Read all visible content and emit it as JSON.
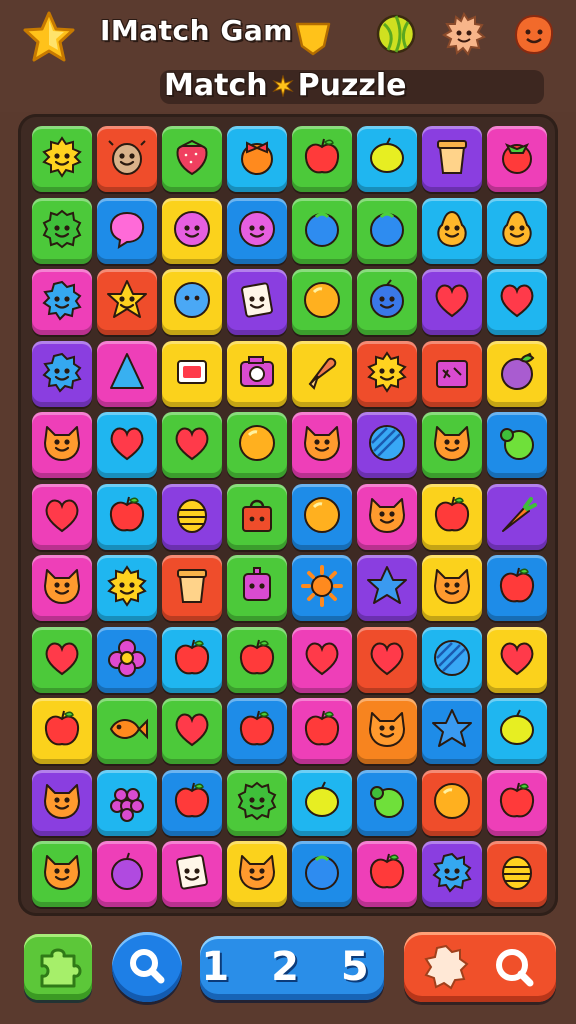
{
  "header": {
    "title": "IMatch Gam",
    "subtitle_left": "Match",
    "subtitle_right": "Puzzle"
  },
  "board": {
    "columns": 8,
    "rows": 11,
    "tiles": [
      [
        {
          "bg": "#4cc93a",
          "icon": "sun-face-icon"
        },
        {
          "bg": "#ef4d2b",
          "icon": "cow-face-icon"
        },
        {
          "bg": "#4cc93a",
          "icon": "strawberry-icon"
        },
        {
          "bg": "#1fb6f0",
          "icon": "orange-bow-icon"
        },
        {
          "bg": "#4cc93a",
          "icon": "apple-icon"
        },
        {
          "bg": "#1fb6f0",
          "icon": "lemon-icon"
        },
        {
          "bg": "#8a3ee0",
          "icon": "cup-icon"
        },
        {
          "bg": "#ee3fb8",
          "icon": "berry-icon"
        }
      ],
      [
        {
          "bg": "#4cc93a",
          "icon": "cactus-face-icon"
        },
        {
          "bg": "#1e8ce8",
          "icon": "bubble-icon"
        },
        {
          "bg": "#fbd21c",
          "icon": "grape-face-icon"
        },
        {
          "bg": "#1e8ce8",
          "icon": "grape-face-icon"
        },
        {
          "bg": "#4cc93a",
          "icon": "blueberry-icon"
        },
        {
          "bg": "#4cc93a",
          "icon": "blueberry-icon"
        },
        {
          "bg": "#1fb6f0",
          "icon": "pear-face-icon"
        },
        {
          "bg": "#1fb6f0",
          "icon": "pear-face-icon"
        }
      ],
      [
        {
          "bg": "#ee3fb8",
          "icon": "splat-face-icon"
        },
        {
          "bg": "#ef4d2b",
          "icon": "star-face-icon"
        },
        {
          "bg": "#fbd21c",
          "icon": "blue-ball-icon"
        },
        {
          "bg": "#8a3ee0",
          "icon": "card-face-icon"
        },
        {
          "bg": "#4cc93a",
          "icon": "orange-ball-icon"
        },
        {
          "bg": "#4cc93a",
          "icon": "plum-face-icon"
        },
        {
          "bg": "#8a3ee0",
          "icon": "heart-icon"
        },
        {
          "bg": "#1fb6f0",
          "icon": "heart-icon"
        }
      ],
      [
        {
          "bg": "#8a3ee0",
          "icon": "splat-face-icon"
        },
        {
          "bg": "#ee3fb8",
          "icon": "triangle-icon"
        },
        {
          "bg": "#fbd21c",
          "icon": "red-square-icon"
        },
        {
          "bg": "#fbd21c",
          "icon": "camera-icon"
        },
        {
          "bg": "#fbd21c",
          "icon": "icecream-icon"
        },
        {
          "bg": "#ef4d2b",
          "icon": "sun-face-icon"
        },
        {
          "bg": "#ef4d2b",
          "icon": "gift-box-icon"
        },
        {
          "bg": "#fbd21c",
          "icon": "fig-icon"
        }
      ],
      [
        {
          "bg": "#ee3fb8",
          "icon": "cat-face-icon"
        },
        {
          "bg": "#1fb6f0",
          "icon": "heart-icon"
        },
        {
          "bg": "#4cc93a",
          "icon": "heart-icon"
        },
        {
          "bg": "#4cc93a",
          "icon": "orange-ball-icon"
        },
        {
          "bg": "#ee3fb8",
          "icon": "cat-face-icon"
        },
        {
          "bg": "#8a3ee0",
          "icon": "striped-ball-icon"
        },
        {
          "bg": "#4cc93a",
          "icon": "cat-face-icon"
        },
        {
          "bg": "#1e8ce8",
          "icon": "lime-icon"
        }
      ],
      [
        {
          "bg": "#ee3fb8",
          "icon": "heart-icon"
        },
        {
          "bg": "#1fb6f0",
          "icon": "apple-icon"
        },
        {
          "bg": "#8a3ee0",
          "icon": "hive-icon"
        },
        {
          "bg": "#4cc93a",
          "icon": "bag-icon"
        },
        {
          "bg": "#1e8ce8",
          "icon": "orange-ball-icon"
        },
        {
          "bg": "#ee3fb8",
          "icon": "cat-face-icon"
        },
        {
          "bg": "#fbd21c",
          "icon": "apple-icon"
        },
        {
          "bg": "#8a3ee0",
          "icon": "carrot-icon"
        }
      ],
      [
        {
          "bg": "#ee3fb8",
          "icon": "cat-face-icon"
        },
        {
          "bg": "#1fb6f0",
          "icon": "sun-face-icon"
        },
        {
          "bg": "#ef4d2b",
          "icon": "cup-icon"
        },
        {
          "bg": "#4cc93a",
          "icon": "robot-icon"
        },
        {
          "bg": "#1e8ce8",
          "icon": "sun-icon"
        },
        {
          "bg": "#8a3ee0",
          "icon": "star-icon"
        },
        {
          "bg": "#fbd21c",
          "icon": "cat-face-icon"
        },
        {
          "bg": "#1e8ce8",
          "icon": "apple-icon"
        }
      ],
      [
        {
          "bg": "#4cc93a",
          "icon": "heart-icon"
        },
        {
          "bg": "#1e8ce8",
          "icon": "flower-icon"
        },
        {
          "bg": "#1fb6f0",
          "icon": "apple-icon"
        },
        {
          "bg": "#4cc93a",
          "icon": "apple-icon"
        },
        {
          "bg": "#ee3fb8",
          "icon": "heart-icon"
        },
        {
          "bg": "#ef4d2b",
          "icon": "heart-icon"
        },
        {
          "bg": "#1fb6f0",
          "icon": "striped-ball-icon"
        },
        {
          "bg": "#fbd21c",
          "icon": "heart-icon"
        }
      ],
      [
        {
          "bg": "#fbd21c",
          "icon": "apple-icon"
        },
        {
          "bg": "#4cc93a",
          "icon": "fish-icon"
        },
        {
          "bg": "#4cc93a",
          "icon": "heart-icon"
        },
        {
          "bg": "#1e8ce8",
          "icon": "apple-icon"
        },
        {
          "bg": "#ee3fb8",
          "icon": "apple-icon"
        },
        {
          "bg": "#f7841f",
          "icon": "cat-face-icon"
        },
        {
          "bg": "#1e8ce8",
          "icon": "star-icon"
        },
        {
          "bg": "#1fb6f0",
          "icon": "lemon-icon"
        }
      ],
      [
        {
          "bg": "#8a3ee0",
          "icon": "cat-face-icon"
        },
        {
          "bg": "#1fb6f0",
          "icon": "raspberry-icon"
        },
        {
          "bg": "#1e8ce8",
          "icon": "apple-icon"
        },
        {
          "bg": "#4cc93a",
          "icon": "cactus-face-icon"
        },
        {
          "bg": "#1fb6f0",
          "icon": "lemon-icon"
        },
        {
          "bg": "#1e8ce8",
          "icon": "lime-icon"
        },
        {
          "bg": "#ef4d2b",
          "icon": "orange-ball-icon"
        },
        {
          "bg": "#ee3fb8",
          "icon": "apple-icon"
        }
      ],
      [
        {
          "bg": "#4cc93a",
          "icon": "cat-face-icon"
        },
        {
          "bg": "#ee3fb8",
          "icon": "plum-icon"
        },
        {
          "bg": "#ee3fb8",
          "icon": "card-face-icon"
        },
        {
          "bg": "#fbd21c",
          "icon": "cat-face-icon"
        },
        {
          "bg": "#1e8ce8",
          "icon": "blueberry-icon"
        },
        {
          "bg": "#ee3fb8",
          "icon": "apple-icon"
        },
        {
          "bg": "#8a3ee0",
          "icon": "splat-face-icon"
        },
        {
          "bg": "#ef4d2b",
          "icon": "hive-icon"
        }
      ]
    ]
  },
  "footer": {
    "score": "1 2 5"
  }
}
